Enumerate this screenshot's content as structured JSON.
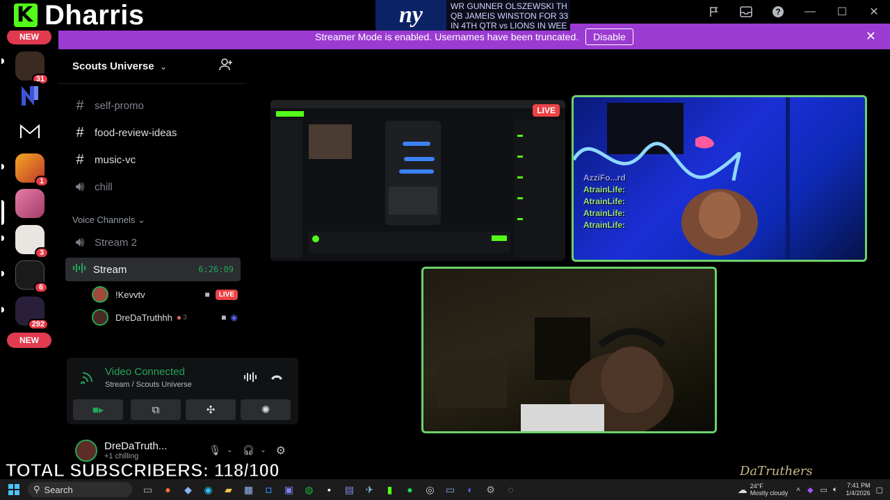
{
  "overlay": {
    "brand_name": "Dharris",
    "subscribers": "TOTAL SUBSCRIBERS: 118/100",
    "watermark": "DaTruthers"
  },
  "ticker": {
    "line1": "WR GUNNER OLSZEWSKI TH",
    "line2": "QB JAMEIS WINSTON FOR 33",
    "line3": "IN 4TH QTR vs LIONS IN WEE",
    "logo_text": "ny"
  },
  "banner": {
    "message": "Streamer Mode is enabled. Usernames have been truncated.",
    "disable_label": "Disable"
  },
  "rail": {
    "new_label_top": "NEW",
    "new_label_bottom": "NEW",
    "badges": [
      "31",
      "1",
      "3",
      "6",
      "292"
    ]
  },
  "server": {
    "name": "Scouts Universe"
  },
  "channels": {
    "text": [
      {
        "name": "self-promo",
        "muted": true
      },
      {
        "name": "food-review-ideas",
        "muted": false
      },
      {
        "name": "music-vc",
        "muted": false
      }
    ],
    "voice_top": {
      "name": "chill"
    },
    "voice_header": "Voice Channels",
    "voice": [
      {
        "name": "Stream 2"
      }
    ],
    "active_stream": {
      "name": "Stream",
      "duration": "6:26:09",
      "users": [
        {
          "name": "!Kevvtv",
          "live": "LIVE"
        },
        {
          "name": "DreDaTruthhh",
          "extra": "3"
        }
      ]
    }
  },
  "voice_panel": {
    "status": "Video Connected",
    "location": "Stream / Scouts Universe"
  },
  "user_panel": {
    "username": "DreDaTruth...",
    "status": "chilling",
    "extra": "+1"
  },
  "stage": {
    "live_tag": "LIVE",
    "overlay_chat_name": "AzziFo...rd",
    "overlay_chat_lines": [
      "AtrainLife:",
      "AtrainLife:",
      "AtrainLife:",
      "AtrainLife:"
    ]
  },
  "taskbar": {
    "search_label": "Search",
    "weather_temp": "24°F",
    "weather_desc": "Mostly cloudy",
    "time": "7:41 PM",
    "date": "1/4/2026"
  },
  "colors": {
    "banner": "#9b3bd1",
    "live": "#ed4245",
    "connected": "#23a559",
    "kick_green": "#53fc18"
  }
}
